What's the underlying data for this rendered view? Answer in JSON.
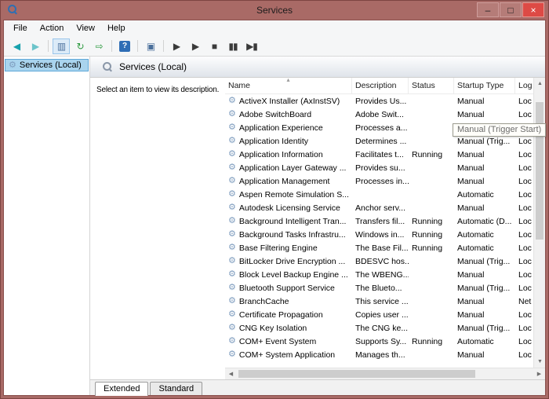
{
  "window": {
    "title": "Services",
    "controls": {
      "minimize": "–",
      "maximize": "□",
      "close": "×"
    }
  },
  "menubar": {
    "items": [
      {
        "label": "File",
        "name": "menu-file"
      },
      {
        "label": "Action",
        "name": "menu-action"
      },
      {
        "label": "View",
        "name": "menu-view"
      },
      {
        "label": "Help",
        "name": "menu-help"
      }
    ]
  },
  "toolbar": {
    "icons": [
      {
        "name": "back-icon",
        "glyph": "◀",
        "color": "#17a2ad"
      },
      {
        "name": "forward-icon",
        "glyph": "▶",
        "color": "#6cc4ca"
      },
      {
        "name": "toolbar-separator",
        "cls": "sep",
        "glyph": "",
        "noninteractive": true
      },
      {
        "name": "show-console-tree-icon",
        "glyph": "▥",
        "color": "#4a6f9b",
        "pressed": true
      },
      {
        "name": "refresh-icon",
        "glyph": "↻",
        "color": "#2c9a3f"
      },
      {
        "name": "export-list-icon",
        "glyph": "⇨",
        "color": "#2c9a3f"
      },
      {
        "name": "toolbar-separator",
        "cls": "sep",
        "glyph": "",
        "noninteractive": true
      },
      {
        "name": "help-icon",
        "glyph": "?",
        "cls": "help",
        "color": "#ffffff"
      },
      {
        "name": "toolbar-separator",
        "cls": "sep",
        "glyph": "",
        "noninteractive": true
      },
      {
        "name": "properties-icon",
        "glyph": "▣",
        "color": "#4a6f9b"
      },
      {
        "name": "toolbar-separator",
        "cls": "sep",
        "glyph": "",
        "noninteractive": true
      },
      {
        "name": "start-service-icon",
        "glyph": "▶",
        "color": "#3a3a3a"
      },
      {
        "name": "resume-service-icon",
        "glyph": "▶",
        "color": "#3a3a3a"
      },
      {
        "name": "stop-service-icon",
        "glyph": "■",
        "color": "#3a3a3a"
      },
      {
        "name": "pause-service-icon",
        "glyph": "▮▮",
        "color": "#3a3a3a"
      },
      {
        "name": "restart-service-icon",
        "glyph": "▶▮",
        "color": "#3a3a3a"
      }
    ]
  },
  "tree": {
    "items": [
      {
        "label": "Services (Local)",
        "name": "tree-item-services-local",
        "selected": true,
        "icon": "⚙"
      }
    ]
  },
  "main": {
    "header_title": "Services (Local)",
    "description_hint": "Select an item to view its description."
  },
  "table": {
    "columns": [
      {
        "label": "Name",
        "cls": "c-name",
        "name": "column-header-name",
        "sort_glyph": "▴"
      },
      {
        "label": "Description",
        "cls": "c-desc",
        "name": "column-header-description"
      },
      {
        "label": "Status",
        "cls": "c-status",
        "name": "column-header-status"
      },
      {
        "label": "Startup Type",
        "cls": "c-startup",
        "name": "column-header-startup-type"
      },
      {
        "label": "Log",
        "cls": "c-logon",
        "name": "column-header-log-on-as"
      }
    ],
    "rows": [
      {
        "name2": "ActiveX Installer (AxInstSV)",
        "description": "Provides Us...",
        "status": "",
        "startup": "Manual",
        "logon": "Loc"
      },
      {
        "name2": "Adobe SwitchBoard",
        "description": "Adobe Swit...",
        "status": "",
        "startup": "Manual",
        "logon": "Loc"
      },
      {
        "name2": "Application Experience",
        "description": "Processes a...",
        "status": "",
        "startup": "",
        "logon": ""
      },
      {
        "name2": "Application Identity",
        "description": "Determines ...",
        "status": "",
        "startup": "Manual (Trig...",
        "logon": "Loc"
      },
      {
        "name2": "Application Information",
        "description": "Facilitates t...",
        "status": "Running",
        "startup": "Manual",
        "logon": "Loc"
      },
      {
        "name2": "Application Layer Gateway ...",
        "description": "Provides su...",
        "status": "",
        "startup": "Manual",
        "logon": "Loc"
      },
      {
        "name2": "Application Management",
        "description": "Processes in...",
        "status": "",
        "startup": "Manual",
        "logon": "Loc"
      },
      {
        "name2": "Aspen Remote Simulation S...",
        "description": "",
        "status": "",
        "startup": "Automatic",
        "logon": "Loc"
      },
      {
        "name2": "Autodesk Licensing Service",
        "description": "Anchor serv...",
        "status": "",
        "startup": "Manual",
        "logon": "Loc"
      },
      {
        "name2": "Background Intelligent Tran...",
        "description": "Transfers fil...",
        "status": "Running",
        "startup": "Automatic (D...",
        "logon": "Loc"
      },
      {
        "name2": "Background Tasks Infrastru...",
        "description": "Windows in...",
        "status": "Running",
        "startup": "Automatic",
        "logon": "Loc"
      },
      {
        "name2": "Base Filtering Engine",
        "description": "The Base Fil...",
        "status": "Running",
        "startup": "Automatic",
        "logon": "Loc"
      },
      {
        "name2": "BitLocker Drive Encryption ...",
        "description": "BDESVC hos...",
        "status": "",
        "startup": "Manual (Trig...",
        "logon": "Loc"
      },
      {
        "name2": "Block Level Backup Engine ...",
        "description": "The WBENG...",
        "status": "",
        "startup": "Manual",
        "logon": "Loc"
      },
      {
        "name2": "Bluetooth Support Service",
        "description": "The Blueto...",
        "status": "",
        "startup": "Manual (Trig...",
        "logon": "Loc"
      },
      {
        "name2": "BranchCache",
        "description": "This service ...",
        "status": "",
        "startup": "Manual",
        "logon": "Net"
      },
      {
        "name2": "Certificate Propagation",
        "description": "Copies user ...",
        "status": "",
        "startup": "Manual",
        "logon": "Loc"
      },
      {
        "name2": "CNG Key Isolation",
        "description": "The CNG ke...",
        "status": "",
        "startup": "Manual (Trig...",
        "logon": "Loc"
      },
      {
        "name2": "COM+ Event System",
        "description": "Supports Sy...",
        "status": "Running",
        "startup": "Automatic",
        "logon": "Loc"
      },
      {
        "name2": "COM+ System Application",
        "description": "Manages th...",
        "status": "",
        "startup": "Manual",
        "logon": "Loc"
      }
    ]
  },
  "icons": {
    "gear": "⚙"
  },
  "scrollbar": {
    "up": "▲",
    "down": "▼",
    "left": "◀",
    "right": "▶"
  },
  "tabs": {
    "items": [
      {
        "label": "Extended",
        "name": "tab-extended",
        "selected": true
      },
      {
        "label": "Standard",
        "name": "tab-standard"
      }
    ]
  },
  "tooltip": {
    "text": "Manual (Trigger Start)"
  },
  "colors": {
    "titlebar": "#a96a66",
    "close_button": "#dd4a45",
    "selection": "#a9d4ee",
    "toolbar_teal": "#17a2ad",
    "gear_icon": "#7f9dbf"
  }
}
